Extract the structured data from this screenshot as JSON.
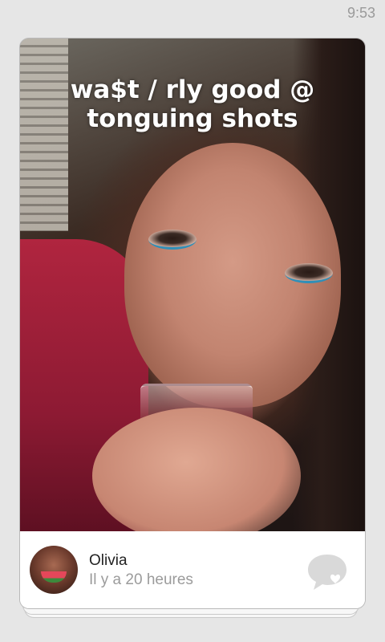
{
  "status_bar": {
    "time": "9:53"
  },
  "post": {
    "caption": "wa$t / rly good @\ntonguing shots",
    "author": "Olivia",
    "timestamp": "Il y a 20 heures",
    "comment_icon": "speech-bubble-heart-icon"
  },
  "colors": {
    "background": "#e6e6e6",
    "card": "#ffffff",
    "caption_text": "#ffffff",
    "author_text": "#222222",
    "timestamp_text": "#9b9b9b",
    "icon": "#d9d9d9"
  }
}
